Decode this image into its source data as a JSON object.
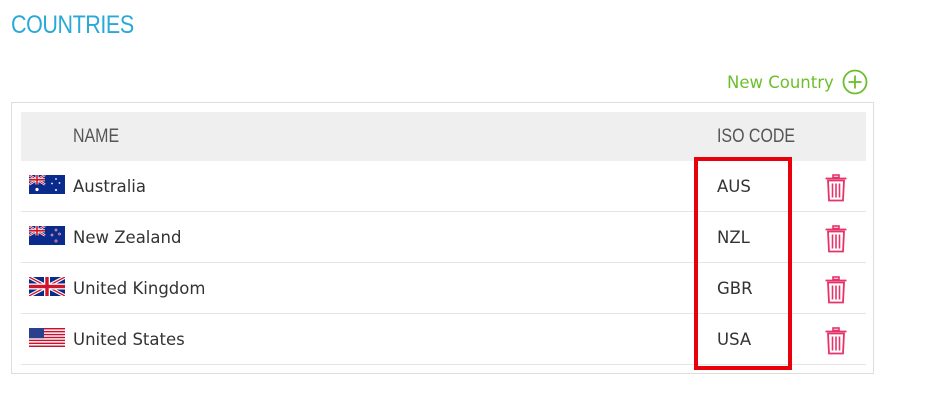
{
  "page": {
    "title": "COUNTRIES"
  },
  "toolbar": {
    "new_label": "New Country"
  },
  "table": {
    "headers": {
      "name": "NAME",
      "iso": "ISO CODE"
    },
    "rows": [
      {
        "name": "Australia",
        "iso": "AUS",
        "flag": "australia-flag-icon"
      },
      {
        "name": "New Zealand",
        "iso": "NZL",
        "flag": "new-zealand-flag-icon"
      },
      {
        "name": "United Kingdom",
        "iso": "GBR",
        "flag": "uk-flag-icon"
      },
      {
        "name": "United States",
        "iso": "USA",
        "flag": "us-flag-icon"
      }
    ]
  },
  "colors": {
    "title": "#29a9d8",
    "new_button": "#6cbf2c",
    "delete_icon": "#e6336a",
    "highlight_box": "#e8000b",
    "header_bg": "#efefef"
  }
}
